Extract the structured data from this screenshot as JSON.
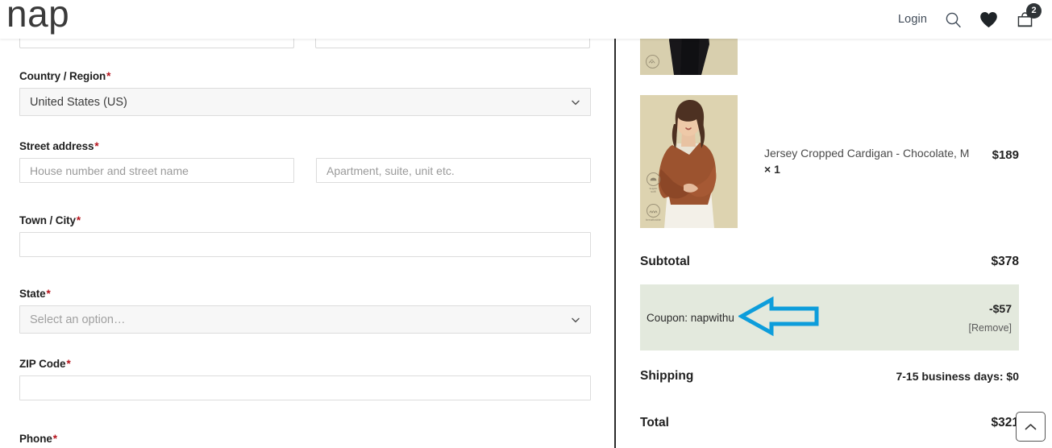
{
  "header": {
    "logo": "nap",
    "login_label": "Login",
    "search_icon": "search-icon",
    "wishlist_icon": "heart-icon",
    "bag_icon": "shopping-bag-icon",
    "bag_count": "2"
  },
  "checkout_form": {
    "fields": [
      {
        "label": "Country / Region",
        "required": "*",
        "type": "select",
        "value": "United States (US)",
        "is_placeholder": false
      },
      {
        "label": "Street address",
        "required": "*",
        "type": "text-pair",
        "placeholder_1": "House number and street name",
        "value_1": "",
        "placeholder_2": "Apartment, suite, unit etc.",
        "value_2": ""
      },
      {
        "label": "Town / City",
        "required": "*",
        "type": "text",
        "placeholder": "",
        "value": ""
      },
      {
        "label": "State",
        "required": "*",
        "type": "select",
        "value": "Select an option…",
        "is_placeholder": true
      },
      {
        "label": "ZIP Code",
        "required": "*",
        "type": "text",
        "placeholder": "",
        "value": ""
      },
      {
        "label": "Phone",
        "required": "*",
        "type": "text",
        "placeholder": "",
        "value": ""
      }
    ]
  },
  "order_summary": {
    "items": [
      {
        "name": "",
        "quantity": "",
        "price": "",
        "partially_visible": true
      },
      {
        "name": "Jersey Cropped Cardigan - Chocolate, M",
        "quantity": "× 1",
        "price": "$189",
        "partially_visible": false
      }
    ],
    "subtotal_label": "Subtotal",
    "subtotal_value": "$378",
    "coupon_label": "Coupon: napwithu",
    "coupon_amount": "-$57",
    "coupon_remove": "[Remove]",
    "shipping_label": "Shipping",
    "shipping_value": "7-15 business days: $0",
    "total_label": "Total",
    "total_value": "$321"
  },
  "annotation": {
    "arrow_color": "#0d9ddb",
    "arrow_direction": "left",
    "points_at": "Coupon: napwithu"
  },
  "scroll_top": {
    "icon": "chevron-up-icon"
  },
  "colors": {
    "coupon_background": "#e3e9dd",
    "required_asterisk": "#b5121b",
    "thumbnail_background": "#ddd3b0",
    "divider": "#2b2b2b"
  }
}
